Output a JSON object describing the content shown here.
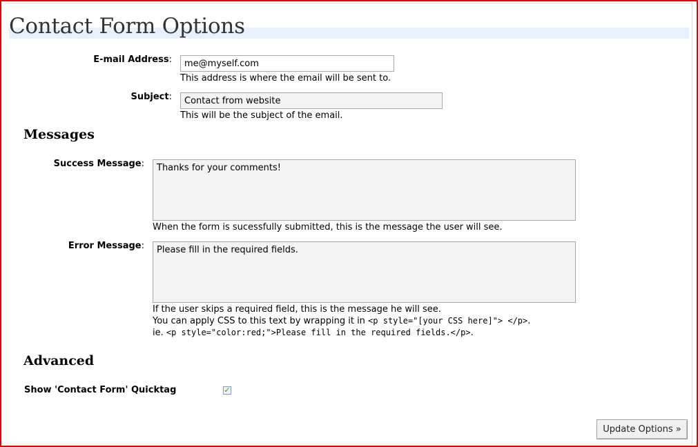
{
  "page": {
    "title": "Contact Form Options"
  },
  "form": {
    "email_label": "E-mail Address",
    "email_value": "me@myself.com",
    "email_hint": "This address is where the email will be sent to.",
    "subject_label": "Subject",
    "subject_value": "Contact from website",
    "subject_hint": "This will be the subject of the email."
  },
  "messages": {
    "heading": "Messages",
    "success_label": "Success Message",
    "success_value": "Thanks for your comments!",
    "success_hint": "When the form is sucessfully submitted, this is the message the user will see.",
    "error_label": "Error Message",
    "error_value": "Please fill in the required fields.",
    "error_hint_1": "If the user skips a required field, this is the message he will see.",
    "error_hint_2_prefix": "You can apply CSS to this text by wrapping it in ",
    "error_hint_2_code": "<p style=\"[your CSS here]\"> </p>",
    "error_hint_2_suffix": ".",
    "error_hint_3_prefix": "ie. ",
    "error_hint_3_code": "<p style=\"color:red;\">Please fill in the required fields.</p>",
    "error_hint_3_suffix": "."
  },
  "advanced": {
    "heading": "Advanced",
    "quicktag_label": "Show 'Contact Form' Quicktag",
    "quicktag_checked": true,
    "check_glyph": "✓"
  },
  "actions": {
    "update_label": "Update Options »"
  },
  "colon": ":"
}
